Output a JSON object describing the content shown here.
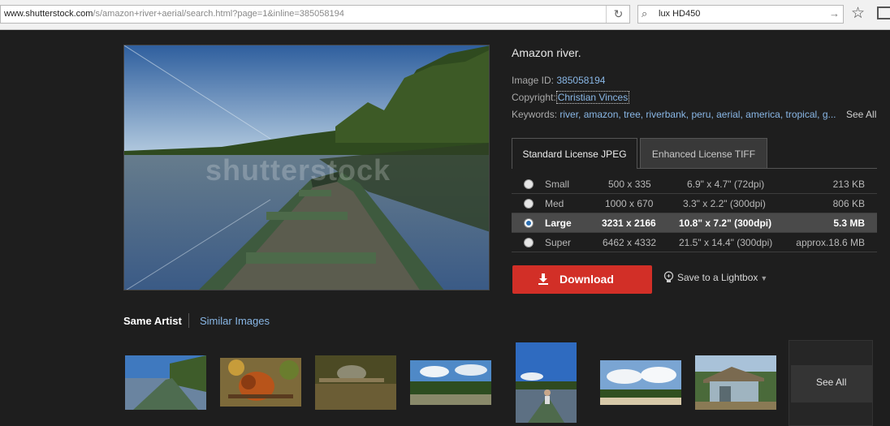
{
  "browser": {
    "url_host": "www.shutterstock.com",
    "url_path": "/s/amazon+river+aerial/search.html?page=1&inline=385058194",
    "search_query": "lux HD450"
  },
  "photo": {
    "watermark": "shutterstock"
  },
  "details": {
    "title": "Amazon river.",
    "image_id_label": "Image ID:",
    "image_id": "385058194",
    "copyright_label": "Copyright:",
    "copyright": "Christian Vinces",
    "keywords_label": "Keywords:",
    "keywords": "river, amazon, tree, riverbank, peru, aerial, america, tropical, g...",
    "keywords_see_all": "See All"
  },
  "license_tabs": {
    "standard": "Standard License JPEG",
    "enhanced": "Enhanced License TIFF"
  },
  "sizes": [
    {
      "name": "Small",
      "pixels": "500 x 335",
      "inches": "6.9\" x 4.7\"  (72dpi)",
      "filesize": "213 KB",
      "selected": false
    },
    {
      "name": "Med",
      "pixels": "1000 x 670",
      "inches": "3.3\" x 2.2\"  (300dpi)",
      "filesize": "806 KB",
      "selected": false
    },
    {
      "name": "Large",
      "pixels": "3231 x 2166",
      "inches": "10.8\" x 7.2\"  (300dpi)",
      "filesize": "5.3 MB",
      "selected": true
    },
    {
      "name": "Super",
      "pixels": "6462 x 4332",
      "inches": "21.5\" x 14.4\"  (300dpi)",
      "filesize": "approx.18.6 MB",
      "selected": false
    }
  ],
  "actions": {
    "download": "Download",
    "lightbox": "Save to a Lightbox"
  },
  "related": {
    "tab_same_artist": "Same Artist",
    "tab_similar": "Similar Images",
    "see_all": "See All"
  },
  "colors": {
    "accent_red": "#d22f27",
    "link_blue": "#89b7e6",
    "background": "#1e1e1e"
  }
}
